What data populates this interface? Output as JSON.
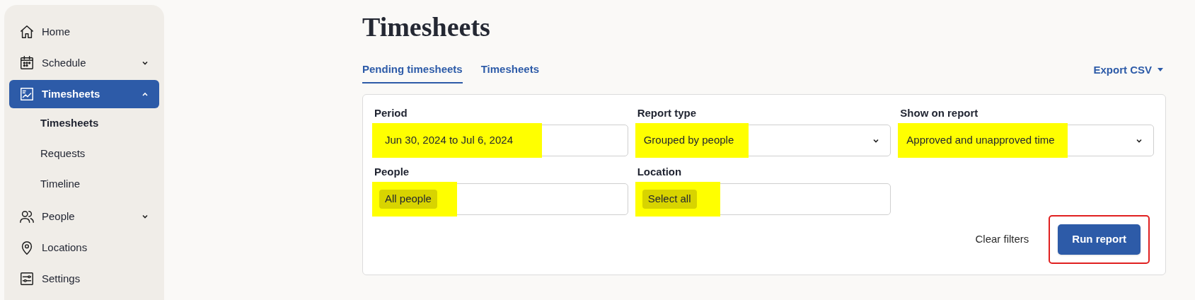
{
  "sidebar": {
    "items": [
      {
        "label": "Home",
        "selected": false
      },
      {
        "label": "Schedule",
        "selected": false,
        "expanded": false
      },
      {
        "label": "Timesheets",
        "selected": true,
        "expanded": true,
        "children": [
          {
            "label": "Timesheets"
          },
          {
            "label": "Requests"
          },
          {
            "label": "Timeline"
          }
        ]
      },
      {
        "label": "People",
        "selected": false,
        "expanded": false
      },
      {
        "label": "Locations",
        "selected": false
      },
      {
        "label": "Settings",
        "selected": false
      }
    ]
  },
  "page_title": "Timesheets",
  "tabs": [
    {
      "label": "Pending timesheets",
      "selected": true
    },
    {
      "label": "Timesheets",
      "selected": false
    }
  ],
  "export_button": "Export CSV",
  "filters": [
    {
      "label": "Period",
      "kind": "text",
      "value": "Jun 30, 2024 to Jul 6, 2024",
      "highlighted": true
    },
    {
      "label": "Report type",
      "kind": "select",
      "value": "Grouped by people",
      "highlighted": true
    },
    {
      "label": "Show on report",
      "kind": "select",
      "value": "Approved and unapproved time",
      "highlighted": true
    },
    {
      "label": "People",
      "kind": "chip",
      "value": "All people",
      "highlighted": true
    },
    {
      "label": "Location",
      "kind": "chip",
      "value": "Select all",
      "highlighted": true
    }
  ],
  "clear_button": "Clear filters",
  "run_button": {
    "label": "Run report",
    "outlined": true
  }
}
